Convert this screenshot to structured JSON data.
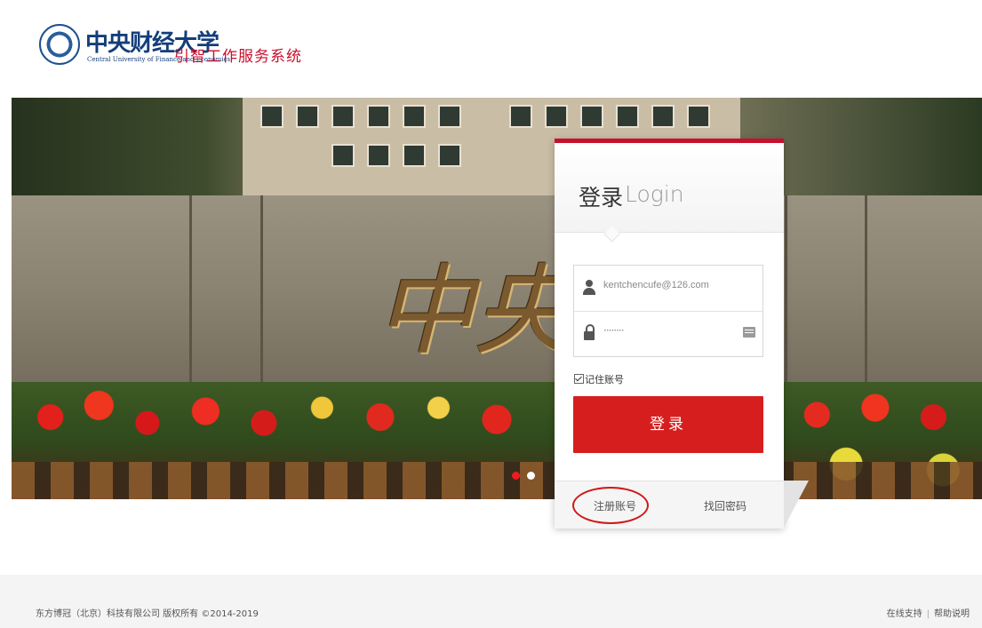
{
  "header": {
    "logo_text": "中央财经大学",
    "logo_subtitle": "Central University of Finance and Economics",
    "system_title": "引智工作服务系统"
  },
  "banner": {
    "carving_text": "中央财",
    "carousel": {
      "total": 2,
      "active_index": 0
    }
  },
  "login": {
    "title_cn": "登录",
    "title_en": "Login",
    "username_value": "kentchencufe@126.com",
    "password_mask": "········",
    "remember_label": "记住账号",
    "remember_checked": true,
    "login_button": "登录",
    "register_link": "注册账号",
    "forgot_link": "找回密码"
  },
  "footer": {
    "copyright": "东方博冠（北京）科技有限公司 版权所有 ©2014-2019",
    "links": [
      "在线支持",
      "帮助说明"
    ],
    "separator": "|"
  },
  "colors": {
    "accent_red": "#c8102e",
    "button_red": "#d71e1e",
    "logo_blue": "#143e7a"
  }
}
